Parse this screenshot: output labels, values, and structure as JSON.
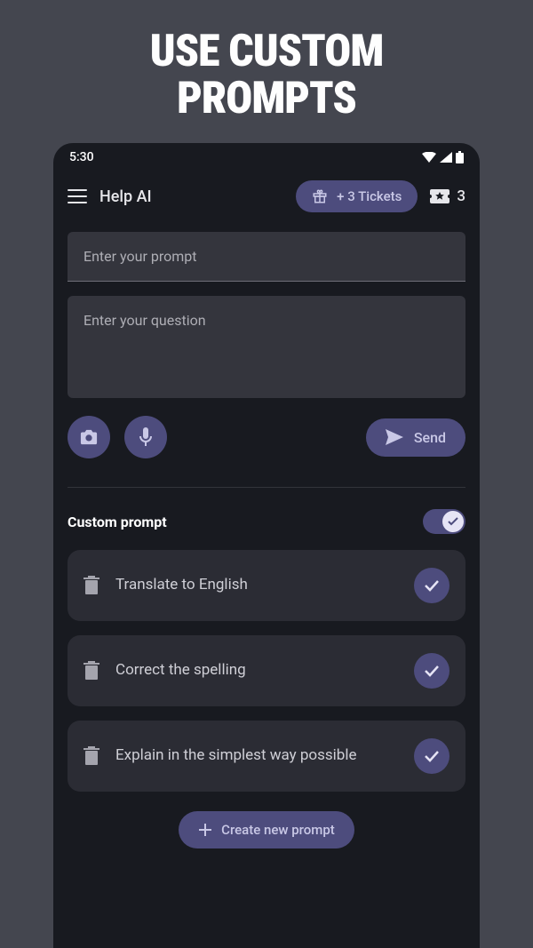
{
  "promo": {
    "title_line1": "USE CUSTOM",
    "title_line2": "PROMPTS"
  },
  "status": {
    "time": "5:30"
  },
  "app": {
    "title": "Help AI",
    "tickets_label": "+ 3 Tickets",
    "ticket_count": "3"
  },
  "inputs": {
    "prompt_placeholder": "Enter your prompt",
    "question_placeholder": "Enter your question"
  },
  "actions": {
    "send": "Send"
  },
  "section": {
    "title": "Custom prompt"
  },
  "prompts": [
    {
      "label": "Translate to English"
    },
    {
      "label": "Correct the spelling"
    },
    {
      "label": "Explain in the simplest way possible"
    }
  ],
  "create": {
    "label": "Create new prompt"
  }
}
